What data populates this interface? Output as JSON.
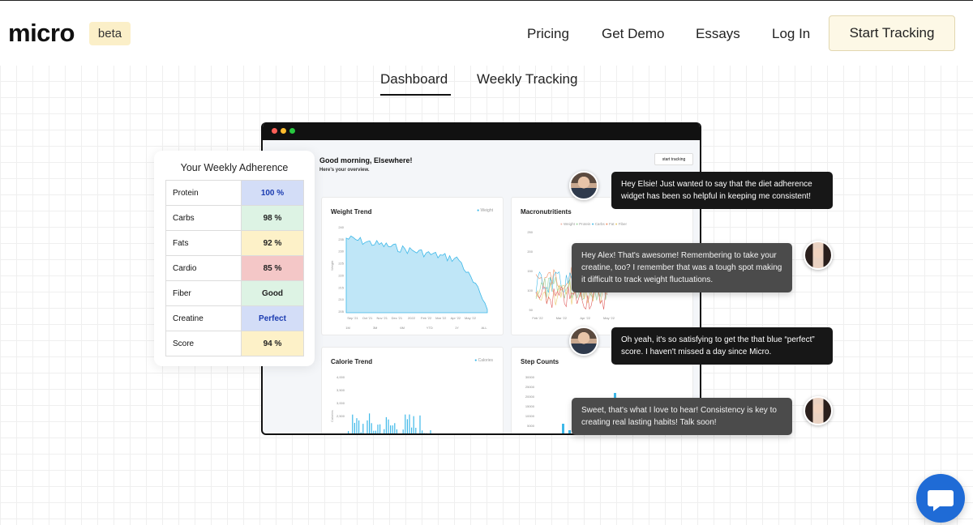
{
  "header": {
    "logo": "micro",
    "badge": "beta",
    "nav": [
      "Pricing",
      "Get Demo",
      "Essays",
      "Log In"
    ],
    "cta": "Start Tracking"
  },
  "tabs": [
    {
      "label": "Dashboard",
      "active": true
    },
    {
      "label": "Weekly Tracking",
      "active": false
    }
  ],
  "dashboard": {
    "greeting": "Good morning, Elsewhere!",
    "subtitle": "Here's your overview.",
    "button": "start tracking",
    "cards": {
      "weight": {
        "title": "Weight Trend",
        "legend": "Weight"
      },
      "macros": {
        "title": "Macronutritients",
        "legend": [
          "Weight",
          "Protein",
          "Carbs",
          "Fat",
          "Fiber"
        ]
      },
      "calorie": {
        "title": "Calorie Trend",
        "legend": "Calories"
      },
      "steps": {
        "title": "Step Counts"
      }
    },
    "weight_chart": {
      "y_ticks": [
        "240",
        "235",
        "230",
        "225",
        "220",
        "215",
        "210",
        "205"
      ],
      "x_ticks": [
        "Sep '21",
        "Oct '21",
        "Nov '21",
        "Dec '21",
        "2022",
        "Feb '22",
        "Mar '22",
        "Apr '22",
        "May '22"
      ],
      "ranges": [
        "1M",
        "3M",
        "6M",
        "YTD",
        "1Y",
        "ALL"
      ],
      "ylabel": "Weight"
    },
    "macro_chart": {
      "y_ticks": [
        "250",
        "200",
        "150",
        "100",
        "50"
      ],
      "x_ticks": [
        "Feb '22",
        "Mar '22",
        "Apr '22",
        "May '22"
      ]
    },
    "calorie_chart": {
      "y_ticks": [
        "4,000",
        "3,500",
        "3,000",
        "2,500"
      ],
      "ylabel": "Calories"
    },
    "step_chart": {
      "y_ticks": [
        "30000",
        "25000",
        "20000",
        "15000",
        "10000",
        "5000"
      ]
    }
  },
  "adherence": {
    "title": "Your Weekly Adherence",
    "rows": [
      {
        "label": "Protein",
        "value": "100 %",
        "color": "#d3ddf7",
        "text_color": "#1a3bb0"
      },
      {
        "label": "Carbs",
        "value": "98 %",
        "color": "#ddf3e4",
        "text_color": "#222"
      },
      {
        "label": "Fats",
        "value": "92 %",
        "color": "#fdf1c8",
        "text_color": "#222"
      },
      {
        "label": "Cardio",
        "value": "85 %",
        "color": "#f4c7c7",
        "text_color": "#222"
      },
      {
        "label": "Fiber",
        "value": "Good",
        "color": "#ddf3e4",
        "text_color": "#222"
      },
      {
        "label": "Creatine",
        "value": "Perfect",
        "color": "#d3ddf7",
        "text_color": "#1a3bb0"
      },
      {
        "label": "Score",
        "value": "94 %",
        "color": "#fdf1c8",
        "text_color": "#222"
      }
    ]
  },
  "chat": [
    {
      "sender": "alex",
      "text": "Hey Elsie! Just wanted to say that the diet adherence widget has been so helpful in keeping me consistent!"
    },
    {
      "sender": "elsie",
      "text": "Hey Alex! That's awesome! Remembering to take your creatine, too? I remember that was a tough spot making it difficult to track weight fluctuations."
    },
    {
      "sender": "alex",
      "text": "Oh yeah, it's so satisfying to get the that blue “perfect” score. I haven't missed a day since Micro."
    },
    {
      "sender": "elsie",
      "text": "Sweet, that's what I love to hear! Consistency is key to creating real lasting habits! Talk soon!"
    }
  ],
  "colors": {
    "accent_blue": "#1f6bd6",
    "chart_blue": "#3db8e8",
    "cta_bg": "#fdf8e6"
  },
  "icons": {
    "chat_widget": "chat-bubble-icon"
  }
}
